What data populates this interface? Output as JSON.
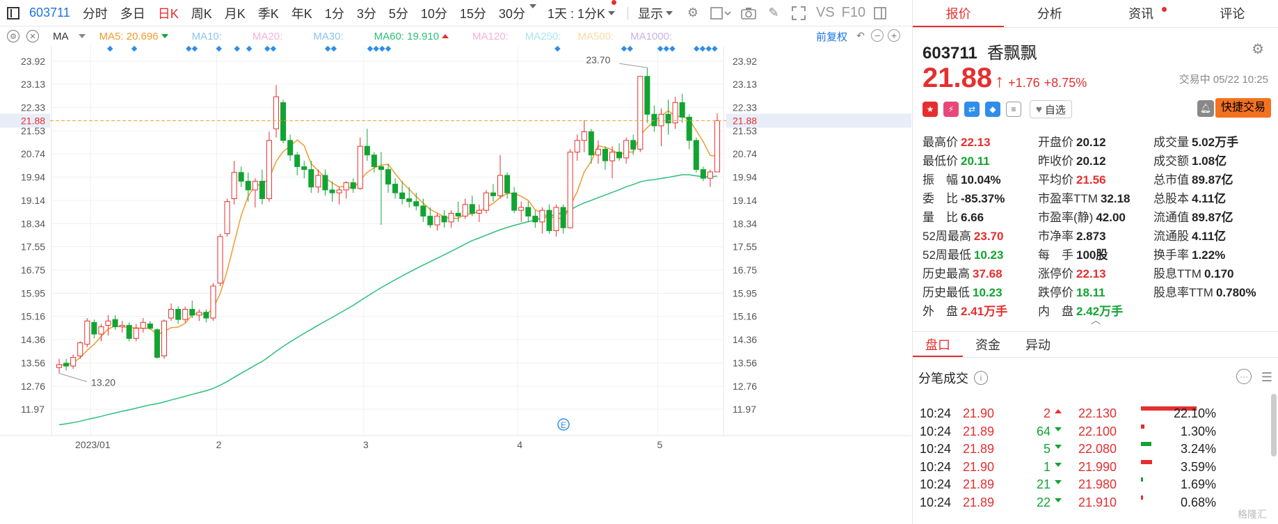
{
  "toolbar": {
    "code": "603711",
    "periods": [
      "分时",
      "多日",
      "日K",
      "周K",
      "月K",
      "季K",
      "年K",
      "1分",
      "3分",
      "5分",
      "10分",
      "15分",
      "30分"
    ],
    "active_period": "日K",
    "range_dropdown": "1天 : 1分K",
    "display_dropdown": "显示",
    "vs_label": "VS",
    "f10_label": "F10"
  },
  "legend": {
    "indicator": "MA",
    "ma5": "MA5: 20.696",
    "ma10": "MA10:",
    "ma20": "MA20:",
    "ma30": "MA30:",
    "ma60": "MA60: 19.910",
    "ma120": "MA120:",
    "ma250": "MA250:",
    "ma500": "MA500:",
    "ma1000": "MA1000:",
    "adjust": "前复权",
    "colors": {
      "ma5": "#f39a2c",
      "ma10": "#8bc4f0",
      "ma20": "#f3b3d6",
      "ma30": "#8bc4f0",
      "ma60": "#2dbf7a",
      "ma120": "#f3b3d6",
      "ma250": "#a6e6f0",
      "ma500": "#f8d9a0",
      "ma1000": "#c9b2e6"
    }
  },
  "chart_data": {
    "type": "candlestick",
    "y_ticks": [
      "23.92",
      "23.13",
      "22.33",
      "21.53",
      "20.74",
      "19.94",
      "19.14",
      "18.34",
      "17.55",
      "16.75",
      "15.95",
      "15.16",
      "14.36",
      "13.56",
      "12.76",
      "11.97"
    ],
    "ylim": [
      11.97,
      23.92
    ],
    "x_labels": [
      "2023/01",
      "2",
      "3",
      "4",
      "5"
    ],
    "current_price_label": "21.88",
    "current_price": 21.88,
    "max_annotation": "23.70",
    "min_annotation": "13.20",
    "up_color": "#e62e2e",
    "down_color": "#11a432",
    "candles": [
      [
        13.4,
        13.7,
        13.2,
        13.5
      ],
      [
        13.55,
        13.7,
        13.3,
        13.45
      ],
      [
        13.45,
        13.85,
        13.35,
        13.75
      ],
      [
        13.8,
        14.3,
        13.7,
        14.25
      ],
      [
        14.2,
        15.1,
        14.1,
        15.0
      ],
      [
        14.95,
        15.05,
        14.4,
        14.55
      ],
      [
        14.55,
        14.9,
        14.3,
        14.8
      ],
      [
        14.85,
        15.2,
        14.5,
        15.0
      ],
      [
        15.05,
        15.2,
        14.7,
        14.8
      ],
      [
        14.8,
        15.0,
        14.6,
        14.85
      ],
      [
        14.85,
        14.95,
        14.3,
        14.4
      ],
      [
        14.4,
        14.9,
        14.3,
        14.75
      ],
      [
        14.75,
        15.1,
        14.6,
        14.95
      ],
      [
        14.9,
        15.0,
        14.7,
        14.75
      ],
      [
        14.7,
        14.75,
        13.7,
        13.75
      ],
      [
        13.8,
        15.05,
        13.7,
        15.0
      ],
      [
        15.1,
        15.6,
        15.0,
        15.4
      ],
      [
        15.4,
        15.5,
        14.9,
        15.05
      ],
      [
        15.05,
        15.5,
        14.95,
        15.4
      ],
      [
        15.4,
        15.7,
        15.1,
        15.2
      ],
      [
        15.2,
        15.4,
        15.0,
        15.3
      ],
      [
        15.3,
        15.4,
        14.95,
        15.1
      ],
      [
        15.1,
        16.3,
        15.0,
        16.2
      ],
      [
        16.3,
        18.0,
        16.2,
        17.9
      ],
      [
        18.0,
        19.2,
        17.9,
        19.1
      ],
      [
        19.2,
        20.5,
        19.0,
        20.1
      ],
      [
        20.1,
        20.3,
        19.6,
        19.8
      ],
      [
        19.8,
        20.1,
        19.1,
        19.5
      ],
      [
        19.5,
        19.9,
        18.9,
        19.8
      ],
      [
        19.8,
        20.2,
        19.0,
        19.2
      ],
      [
        19.2,
        21.5,
        19.1,
        21.2
      ],
      [
        21.6,
        23.1,
        21.3,
        22.7
      ],
      [
        22.5,
        22.6,
        21.1,
        21.2
      ],
      [
        21.2,
        21.4,
        20.5,
        20.7
      ],
      [
        20.7,
        20.8,
        20.0,
        20.3
      ],
      [
        20.3,
        20.5,
        19.9,
        20.2
      ],
      [
        20.2,
        20.5,
        19.4,
        19.6
      ],
      [
        19.6,
        20.2,
        19.4,
        20.0
      ],
      [
        20.0,
        20.2,
        19.3,
        19.5
      ],
      [
        19.5,
        19.8,
        19.1,
        19.4
      ],
      [
        19.4,
        19.6,
        19.0,
        19.5
      ],
      [
        19.5,
        19.8,
        19.2,
        19.75
      ],
      [
        19.75,
        19.9,
        19.4,
        19.55
      ],
      [
        19.55,
        21.3,
        19.5,
        21.0
      ],
      [
        21.0,
        21.6,
        20.5,
        20.7
      ],
      [
        20.7,
        20.8,
        20.1,
        20.3
      ],
      [
        20.3,
        20.8,
        18.3,
        20.2
      ],
      [
        20.2,
        20.4,
        19.4,
        19.7
      ],
      [
        19.7,
        19.9,
        19.2,
        19.4
      ],
      [
        19.4,
        19.8,
        19.0,
        19.2
      ],
      [
        19.2,
        19.6,
        18.9,
        19.1
      ],
      [
        19.1,
        19.4,
        18.8,
        18.95
      ],
      [
        18.95,
        19.2,
        18.4,
        18.6
      ],
      [
        18.6,
        18.9,
        18.2,
        18.3
      ],
      [
        18.3,
        18.7,
        18.1,
        18.6
      ],
      [
        18.6,
        18.8,
        18.2,
        18.4
      ],
      [
        18.4,
        18.8,
        18.2,
        18.7
      ],
      [
        18.7,
        19.1,
        18.4,
        18.6
      ],
      [
        18.6,
        19.2,
        18.5,
        19.0
      ],
      [
        19.0,
        19.3,
        18.6,
        18.7
      ],
      [
        18.7,
        19.0,
        18.4,
        18.8
      ],
      [
        18.8,
        19.5,
        18.7,
        19.4
      ],
      [
        19.4,
        19.7,
        19.1,
        19.3
      ],
      [
        19.3,
        20.7,
        19.2,
        20.0
      ],
      [
        20.0,
        20.1,
        19.2,
        19.4
      ],
      [
        19.4,
        19.6,
        18.7,
        18.8
      ],
      [
        18.8,
        19.1,
        18.4,
        18.9
      ],
      [
        18.9,
        19.1,
        18.4,
        18.6
      ],
      [
        18.6,
        18.8,
        18.2,
        18.4
      ],
      [
        18.4,
        18.9,
        18.0,
        18.8
      ],
      [
        18.8,
        19.0,
        18.0,
        18.1
      ],
      [
        18.1,
        19.0,
        17.9,
        18.9
      ],
      [
        18.9,
        19.0,
        18.0,
        18.2
      ],
      [
        18.2,
        20.9,
        18.2,
        20.8
      ],
      [
        20.8,
        21.4,
        20.5,
        21.2
      ],
      [
        21.2,
        21.9,
        20.8,
        21.5
      ],
      [
        21.5,
        21.6,
        20.4,
        20.7
      ],
      [
        20.7,
        21.2,
        20.4,
        20.9
      ],
      [
        20.9,
        21.0,
        20.2,
        20.5
      ],
      [
        20.5,
        21.0,
        19.9,
        20.8
      ],
      [
        20.8,
        21.1,
        20.5,
        20.6
      ],
      [
        20.6,
        21.3,
        20.4,
        21.2
      ],
      [
        21.2,
        21.4,
        20.7,
        20.9
      ],
      [
        20.9,
        23.4,
        20.8,
        23.4
      ],
      [
        23.4,
        23.7,
        21.8,
        22.1
      ],
      [
        22.1,
        22.4,
        21.5,
        21.7
      ],
      [
        21.7,
        22.3,
        21.0,
        22.1
      ],
      [
        22.1,
        22.6,
        21.4,
        21.8
      ],
      [
        21.8,
        22.7,
        21.6,
        22.5
      ],
      [
        22.5,
        22.8,
        21.8,
        22.0
      ],
      [
        22.0,
        22.1,
        20.9,
        21.2
      ],
      [
        21.2,
        21.3,
        20.1,
        20.2
      ],
      [
        20.2,
        20.3,
        19.8,
        19.9
      ],
      [
        19.9,
        20.2,
        19.6,
        20.12
      ],
      [
        20.12,
        22.13,
        20.11,
        21.88
      ]
    ]
  },
  "panel": {
    "tabs": [
      "报价",
      "分析",
      "资讯",
      "评论"
    ],
    "active_tab": "报价",
    "code": "603711",
    "name": "香飘飘",
    "price": "21.88",
    "change": "+1.76",
    "change_pct": "+8.75%",
    "trade_status": "交易中 05/22 10:25",
    "watchlist_label": "自选",
    "quick_trade_label": "快捷交易",
    "stats": [
      {
        "label": "最高价",
        "value": "22.13",
        "tone": "up"
      },
      {
        "label": "开盘价",
        "value": "20.12",
        "tone": "dark"
      },
      {
        "label": "成交量",
        "value": "5.02万手",
        "tone": "dark"
      },
      {
        "label": "最低价",
        "value": "20.11",
        "tone": "down"
      },
      {
        "label": "昨收价",
        "value": "20.12",
        "tone": "dark"
      },
      {
        "label": "成交额",
        "value": "1.08亿",
        "tone": "dark"
      },
      {
        "label": "振　幅",
        "value": "10.04%",
        "tone": "dark"
      },
      {
        "label": "平均价",
        "value": "21.56",
        "tone": "up"
      },
      {
        "label": "总市值",
        "value": "89.87亿",
        "tone": "dark"
      },
      {
        "label": "委　比",
        "value": "-85.37%",
        "tone": "dark"
      },
      {
        "label": "市盈率TTM",
        "value": "32.18",
        "tone": "dark"
      },
      {
        "label": "总股本",
        "value": "4.11亿",
        "tone": "dark"
      },
      {
        "label": "量　比",
        "value": "6.66",
        "tone": "dark"
      },
      {
        "label": "市盈率(静)",
        "value": "42.00",
        "tone": "dark"
      },
      {
        "label": "流通值",
        "value": "89.87亿",
        "tone": "dark"
      },
      {
        "label": "52周最高",
        "value": "23.70",
        "tone": "up"
      },
      {
        "label": "市净率",
        "value": "2.873",
        "tone": "dark"
      },
      {
        "label": "流通股",
        "value": "4.11亿",
        "tone": "dark"
      },
      {
        "label": "52周最低",
        "value": "10.23",
        "tone": "down"
      },
      {
        "label": "每　手",
        "value": "100股",
        "tone": "dark"
      },
      {
        "label": "换手率",
        "value": "1.22%",
        "tone": "dark"
      },
      {
        "label": "历史最高",
        "value": "37.68",
        "tone": "up"
      },
      {
        "label": "涨停价",
        "value": "22.13",
        "tone": "up"
      },
      {
        "label": "股息TTM",
        "value": "0.170",
        "tone": "dark"
      },
      {
        "label": "历史最低",
        "value": "10.23",
        "tone": "down"
      },
      {
        "label": "跌停价",
        "value": "18.11",
        "tone": "down"
      },
      {
        "label": "股息率TTM",
        "value": "0.780%",
        "tone": "dark"
      },
      {
        "label": "外　盘",
        "value": "2.41万手",
        "tone": "up"
      },
      {
        "label": "内　盘",
        "value": "2.42万手",
        "tone": "down"
      }
    ],
    "sub_tabs": [
      "盘口",
      "资金",
      "异动"
    ],
    "active_sub_tab": "盘口",
    "trades_title": "分笔成交",
    "trades": [
      {
        "time": "10:24",
        "price": "21.90",
        "vol": "2",
        "dir": "up",
        "p2": "22.130",
        "pct": "22.10%",
        "bar_color": "#e62e2e",
        "bar_pct": 0.8
      },
      {
        "time": "10:24",
        "price": "21.89",
        "vol": "64",
        "dir": "down",
        "p2": "22.100",
        "pct": "1.30%",
        "bar_color": "#e62e2e",
        "bar_pct": 0.05
      },
      {
        "time": "10:24",
        "price": "21.89",
        "vol": "5",
        "dir": "down",
        "p2": "22.080",
        "pct": "3.24%",
        "bar_color": "#11a432",
        "bar_pct": 0.15
      },
      {
        "time": "10:24",
        "price": "21.90",
        "vol": "1",
        "dir": "down",
        "p2": "21.990",
        "pct": "3.59%",
        "bar_color": "#e62e2e",
        "bar_pct": 0.16
      },
      {
        "time": "10:24",
        "price": "21.89",
        "vol": "21",
        "dir": "down",
        "p2": "21.980",
        "pct": "1.69%",
        "bar_color": "#11a432",
        "bar_pct": 0.03
      },
      {
        "time": "10:24",
        "price": "21.89",
        "vol": "22",
        "dir": "down",
        "p2": "21.910",
        "pct": "0.68%",
        "bar_color": "#e62e2e",
        "bar_pct": 0.01
      }
    ],
    "watermark": "格隆汇"
  }
}
